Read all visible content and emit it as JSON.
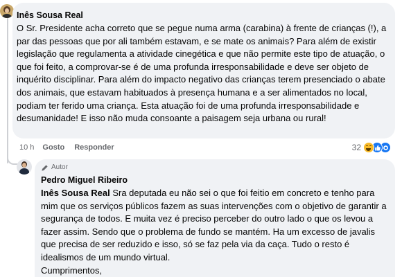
{
  "comment": {
    "author": "Inês Sousa Real",
    "text": "O Sr. Presidente acha correto que se pegue numa arma (carabina) à frente de crianças (!), a par das pessoas que por ali também estavam, e se mate os animais? Para além de existir legislação que regulamenta a atividade cinegética e que não permite este tipo de atuação, o que foi feito, a comprovar-se é de uma profunda irresponsabilidade e deve ser objeto de inquérito disciplinar. Para além do impacto negativo das crianças terem presenciado o abate dos animais, que estavam habituados à presença humana e a ser alimentados no local, podiam ter ferido uma criança. Esta atuação foi de uma profunda irresponsabilidade e desumanidade! E isso não muda consoante a paisagem seja urbana ou rural!",
    "time": "10 h",
    "like_label": "Gosto",
    "reply_label": "Responder",
    "reaction_count": "32",
    "reactions": [
      "haha",
      "like",
      "love"
    ]
  },
  "reply": {
    "badge": "Autor",
    "author": "Pedro Miguel Ribeiro",
    "mention": "Inês Sousa Real",
    "text": " Sra deputada eu não sei o que foi feitio em concreto e tenho para mim que os serviços públicos fazem as suas intervenções com o objetivo de garantir a segurança de todos. E muita vez é preciso perceber do outro lado o que os levou a fazer assim. Sendo que o problema de fundo se mantém. Ha um excesso de javalis que precisa de ser reduzido e isso, só se faz pela via da caça. Tudo o resto é idealismos de um mundo virtual.",
    "signoff": "Cumprimentos,"
  },
  "colors": {
    "bubble": "#f0f2f5",
    "secondary_text": "#65676b",
    "like_blue": "#1877f2",
    "haha_yellow": "#f7b928"
  }
}
